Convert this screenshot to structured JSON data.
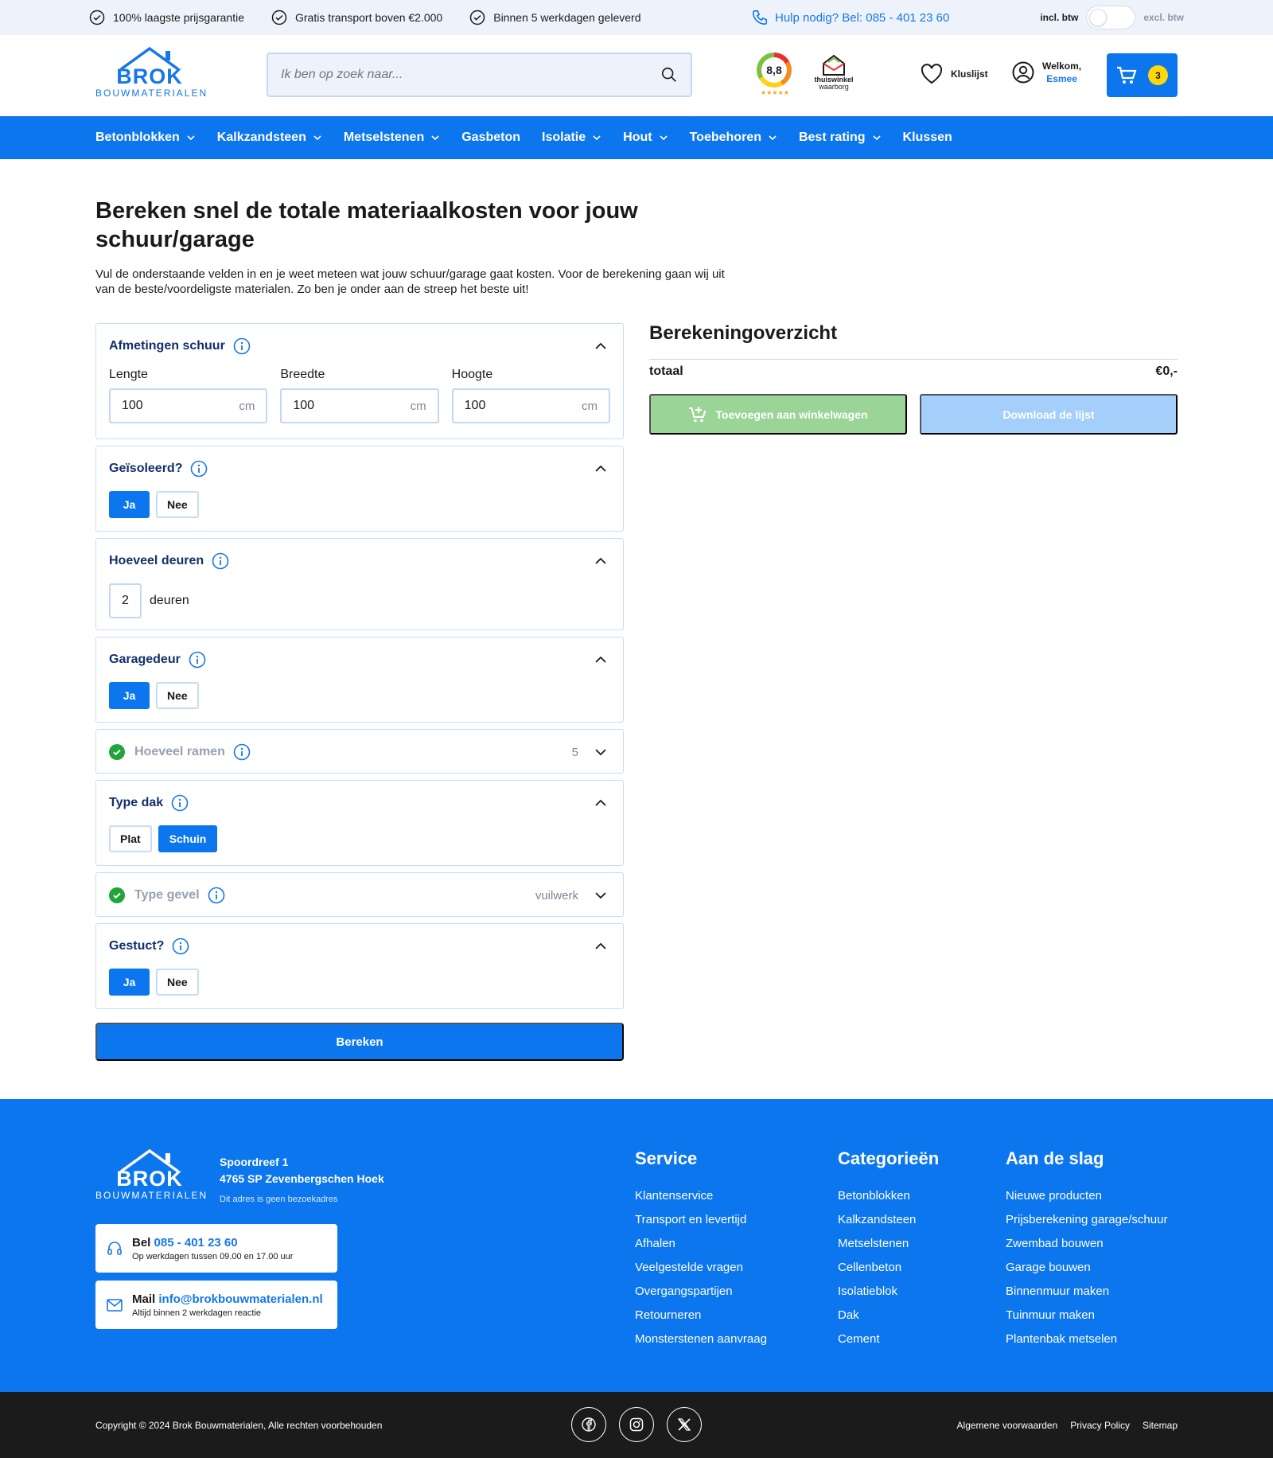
{
  "topbar": {
    "usps": [
      "100% laagste prijsgarantie",
      "Gratis transport boven €2.000",
      "Binnen 5 werkdagen geleverd"
    ],
    "help": "Hulp nodig? Bel: 085 - 401 23 60",
    "incl": "incl. btw",
    "excl": "excl. btw"
  },
  "header": {
    "logo_brand": "BROK",
    "logo_sub": "BOUWMATERIALEN",
    "search_placeholder": "Ik ben op zoek naar...",
    "rating": "8,8",
    "rating_stars": "★★★★★",
    "thuiswinkel_1": "thuiswinkel",
    "thuiswinkel_2": "waarborg",
    "wishlist": "Kluslijst",
    "welcome": "Welkom,",
    "user": "Esmee",
    "cart_count": "3"
  },
  "nav": [
    {
      "label": "Betonblokken",
      "dropdown": true
    },
    {
      "label": "Kalkzandsteen",
      "dropdown": true
    },
    {
      "label": "Metselstenen",
      "dropdown": true
    },
    {
      "label": "Gasbeton",
      "dropdown": false
    },
    {
      "label": "Isolatie",
      "dropdown": true
    },
    {
      "label": "Hout",
      "dropdown": true
    },
    {
      "label": "Toebehoren",
      "dropdown": true
    },
    {
      "label": "Best rating",
      "dropdown": true
    },
    {
      "label": "Klussen",
      "dropdown": false
    }
  ],
  "page": {
    "title": "Bereken snel de totale materiaalkosten voor jouw schuur/garage",
    "intro": "Vul de onderstaande velden in en je weet meteen wat jouw schuur/garage  gaat kosten. Voor de berekening gaan wij uit van de beste/voordeligste  materialen. Zo ben je onder aan de streep het beste uit!"
  },
  "form": {
    "dimensions": {
      "title": "Afmetingen schuur",
      "fields": [
        {
          "label": "Lengte",
          "value": "100",
          "unit": "cm"
        },
        {
          "label": "Breedte",
          "value": "100",
          "unit": "cm"
        },
        {
          "label": "Hoogte",
          "value": "100",
          "unit": "cm"
        }
      ]
    },
    "insulated": {
      "title": "Geïsoleerd?",
      "options": [
        "Ja",
        "Nee"
      ],
      "selected": "Ja"
    },
    "doors": {
      "title": "Hoeveel deuren",
      "value": "2",
      "unit": "deuren"
    },
    "garage_door": {
      "title": "Garagedeur",
      "options": [
        "Ja",
        "Nee"
      ],
      "selected": "Ja"
    },
    "windows": {
      "title": "Hoeveel ramen",
      "value": "5"
    },
    "roof": {
      "title": "Type dak",
      "options": [
        "Plat",
        "Schuin"
      ],
      "selected": "Schuin"
    },
    "facade": {
      "title": "Type gevel",
      "value": "vuilwerk"
    },
    "plastered": {
      "title": "Gestuct?",
      "options": [
        "Ja",
        "Nee"
      ],
      "selected": "Ja"
    },
    "submit": "Bereken"
  },
  "overview": {
    "title": "Berekeningoverzicht",
    "total_label": "totaal",
    "total_value": "€0,-",
    "add_to_cart": "Toevoegen aan winkelwagen",
    "download": "Download de lijst"
  },
  "footer": {
    "address_1": "Spoordreef 1",
    "address_2": "4765 SP Zevenbergschen Hoek",
    "address_note": "Dit adres is geen bezoekadres",
    "call_label": "Bel",
    "call_value": "085 - 401 23 60",
    "call_note": "Op werkdagen tussen 09.00 en 17.00 uur",
    "mail_label": "Mail",
    "mail_value": "info@brokbouwmaterialen.nl",
    "mail_note": "Altijd binnen 2 werkdagen reactie",
    "columns": [
      {
        "title": "Service",
        "items": [
          "Klantenservice",
          "Transport en levertijd",
          "Afhalen",
          "Veelgestelde vragen",
          "Overgangspartijen",
          "Retourneren",
          "Monsterstenen aanvraag"
        ]
      },
      {
        "title": "Categorieën",
        "items": [
          "Betonblokken",
          "Kalkzandsteen",
          "Metselstenen",
          "Cellenbeton",
          "Isolatieblok",
          "Dak",
          "Cement"
        ]
      },
      {
        "title": "Aan de slag",
        "items": [
          "Nieuwe producten",
          "Prijsberekening garage/schuur",
          "Zwembad bouwen",
          "Garage bouwen",
          "Binnenmuur maken",
          "Tuinmuur maken",
          "Plantenbak metselen"
        ]
      }
    ],
    "copyright": "Copyright © 2024 Brok Bouwmaterialen, Alle rechten voorbehouden",
    "legal": [
      "Algemene voorwaarden",
      "Privacy Policy",
      "Sitemap"
    ]
  },
  "colors": {
    "primary": "#0c76ee",
    "success": "#22a43a",
    "badge": "#ffd80a",
    "dark": "#1b1b1b"
  }
}
